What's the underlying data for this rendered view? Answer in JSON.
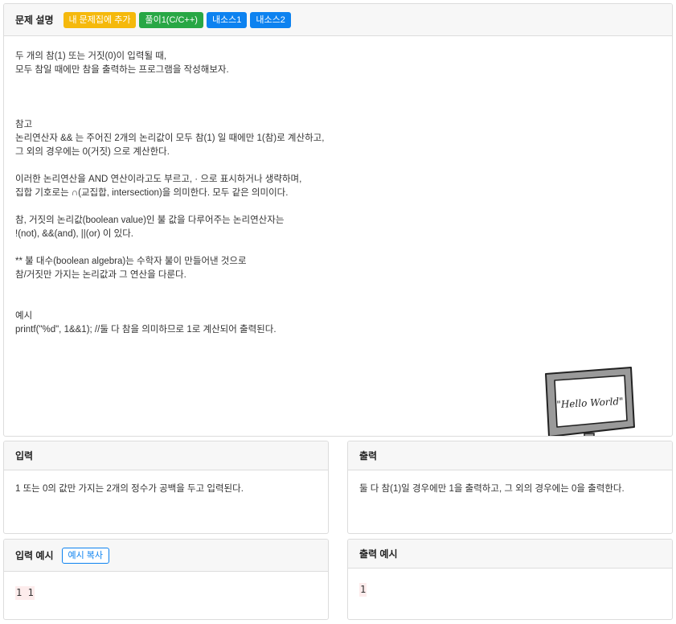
{
  "description": {
    "title": "문제 설명",
    "buttons": {
      "add": "내 문제집에 추가",
      "solution": "풀이1(C/C++)",
      "source1": "내소스1",
      "source2": "내소스2"
    },
    "lines": [
      "두 개의 참(1) 또는 거짓(0)이 입력될 때,",
      "모두 참일 때에만 참을 출력하는 프로그램을 작성해보자.",
      "",
      "",
      "",
      "참고",
      "논리연산자 && 는 주어진 2개의 논리값이 모두 참(1) 일 때에만 1(참)로 계산하고,",
      "그 외의 경우에는 0(거짓) 으로 계산한다.",
      "",
      "이러한 논리연산을 AND 연산이라고도 부르고, · 으로 표시하거나 생략하며,",
      "집합 기호로는 ∩(교집합, intersection)을 의미한다. 모두 같은 의미이다.",
      "",
      "참, 거짓의 논리값(boolean value)인 불 값을 다루어주는 논리연산자는",
      "!(not), &&(and), ||(or) 이 있다.",
      "",
      "** 불 대수(boolean algebra)는 수학자 불이 만들어낸 것으로",
      "참/거짓만 가지는 논리값과 그 연산을 다룬다.",
      "",
      "",
      "예시",
      "printf(\"%d\", 1&&1); //둘 다 참을 의미하므로 1로 계산되어 출력된다."
    ],
    "image_text": "\"Hello World\""
  },
  "input": {
    "title": "입력",
    "text": "1 또는 0의 값만 가지는 2개의 정수가 공백을 두고 입력된다."
  },
  "output": {
    "title": "출력",
    "text": "둘 다 참(1)일 경우에만 1을 출력하고, 그 외의 경우에는 0을 출력한다."
  },
  "input_example": {
    "title": "입력 예시",
    "copy_button": "예시 복사",
    "value": "1 1"
  },
  "output_example": {
    "title": "출력 예시",
    "value": "1"
  },
  "colors": {
    "yellow": "#f5b90c",
    "green": "#28a745",
    "blue": "#0d82f0"
  },
  "icons": [
    "hello-world-monitor-image"
  ]
}
